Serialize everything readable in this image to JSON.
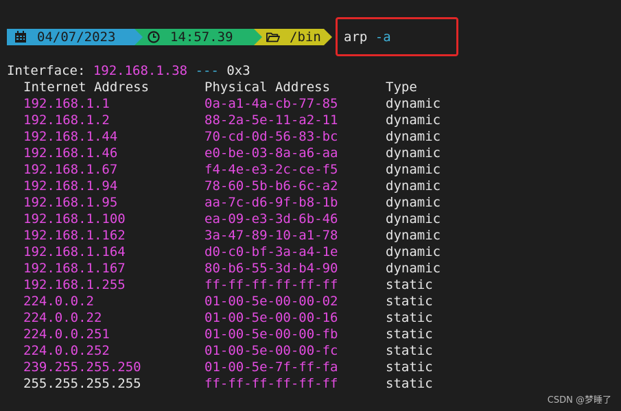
{
  "prompt": {
    "date": "04/07/2023",
    "time": "14:57.39",
    "dir": "/bin",
    "date_icon": "calendar-icon",
    "time_icon": "clock-icon",
    "dir_icon": "folder-open-icon",
    "colors": {
      "date_bg": "#2f9fd0",
      "time_bg": "#22b36a",
      "dir_bg": "#c9c11f"
    }
  },
  "command": {
    "name": "arp",
    "flag": "-a"
  },
  "interface": {
    "label": "Interface:",
    "ip": "192.168.1.38",
    "separator": "---",
    "index": "0x3"
  },
  "table": {
    "headers": [
      "Internet Address",
      "Physical Address",
      "Type"
    ],
    "rows": [
      {
        "ip": "192.168.1.1",
        "mac": "0a-a1-4a-cb-77-85",
        "type": "dynamic"
      },
      {
        "ip": "192.168.1.2",
        "mac": "88-2a-5e-11-a2-11",
        "type": "dynamic"
      },
      {
        "ip": "192.168.1.44",
        "mac": "70-cd-0d-56-83-bc",
        "type": "dynamic"
      },
      {
        "ip": "192.168.1.46",
        "mac": "e0-be-03-8a-a6-aa",
        "type": "dynamic"
      },
      {
        "ip": "192.168.1.67",
        "mac": "f4-4e-e3-2c-ce-f5",
        "type": "dynamic"
      },
      {
        "ip": "192.168.1.94",
        "mac": "78-60-5b-b6-6c-a2",
        "type": "dynamic"
      },
      {
        "ip": "192.168.1.95",
        "mac": "aa-7c-d6-9f-b8-1b",
        "type": "dynamic"
      },
      {
        "ip": "192.168.1.100",
        "mac": "ea-09-e3-3d-6b-46",
        "type": "dynamic"
      },
      {
        "ip": "192.168.1.162",
        "mac": "3a-47-89-10-a1-78",
        "type": "dynamic"
      },
      {
        "ip": "192.168.1.164",
        "mac": "d0-c0-bf-3a-a4-1e",
        "type": "dynamic"
      },
      {
        "ip": "192.168.1.167",
        "mac": "80-b6-55-3d-b4-90",
        "type": "dynamic"
      },
      {
        "ip": "192.168.1.255",
        "mac": "ff-ff-ff-ff-ff-ff",
        "type": "static"
      },
      {
        "ip": "224.0.0.2",
        "mac": "01-00-5e-00-00-02",
        "type": "static"
      },
      {
        "ip": "224.0.0.22",
        "mac": "01-00-5e-00-00-16",
        "type": "static"
      },
      {
        "ip": "224.0.0.251",
        "mac": "01-00-5e-00-00-fb",
        "type": "static"
      },
      {
        "ip": "224.0.0.252",
        "mac": "01-00-5e-00-00-fc",
        "type": "static"
      },
      {
        "ip": "239.255.255.250",
        "mac": "01-00-5e-7f-ff-fa",
        "type": "static"
      },
      {
        "ip": "255.255.255.255",
        "mac": "ff-ff-ff-ff-ff-ff",
        "type": "static"
      }
    ]
  },
  "watermark": "CSDN @梦睡了"
}
